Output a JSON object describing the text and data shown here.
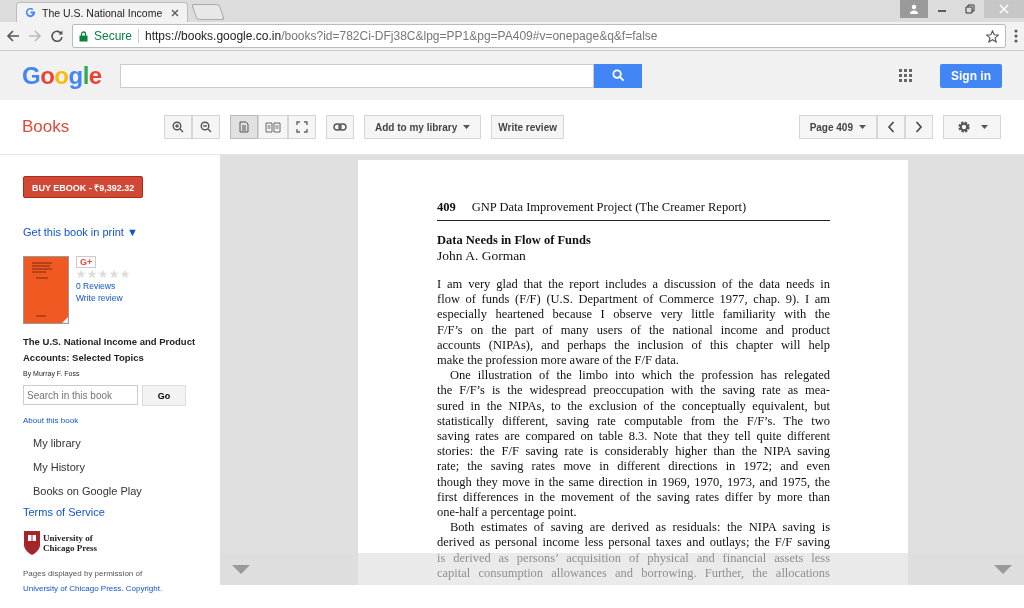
{
  "browser": {
    "tabs": [
      {
        "title": "The U.S. National Income",
        "selected": true
      }
    ],
    "secure_label": "Secure",
    "url_host": "https://books.google.co.in",
    "url_path": "/books?id=782Ci-DFj38C&lpg=PP1&pg=PA409#v=onepage&q&f=false"
  },
  "google_bar": {
    "logo": "Google",
    "sign_in": "Sign in"
  },
  "toolbar": {
    "title": "Books",
    "view_modes": [
      {
        "selected": true
      },
      {
        "selected": false
      },
      {
        "selected": false
      }
    ],
    "add_library": "Add to my library",
    "write_review": "Write review",
    "page": "Page 409"
  },
  "sidebar": {
    "buy": "BUY EBOOK - ₹9,392.32",
    "get_print": "Get this book in print ▼",
    "gplus": "G+",
    "stars": 0,
    "reviews": "0 Reviews",
    "write_review": "Write review",
    "book_title": "The U.S. National Income and Product Accounts: Selected Topics",
    "author": "By Murray F. Foss",
    "search_placeholder": "Search in this book",
    "go": "Go",
    "about": "About this book",
    "nav": [
      "My library",
      "My History",
      "Books on Google Play"
    ],
    "terms": "Terms of Service",
    "publisher": [
      "University of",
      "Chicago Press"
    ],
    "permission": "Pages displayed by permission of ",
    "permission_link": "University of Chicago Press.",
    "copyright": "Copyright."
  },
  "page": {
    "number": "409",
    "running_head": "GNP Data Improvement Project (The Creamer Report)",
    "heading": "Data Needs in Flow of Funds",
    "author": "John A. Gorman",
    "paragraphs": [
      [
        "I am very glad that the report includes a discussion of the data needs in",
        "flow of funds (F/F) (U.S. Department of Commerce 1977, chap. 9). I am",
        "especially heartened because I observe very little familiarity with the",
        "F/F’s on the part of many users of the national income and product",
        "accounts (NIPAs), and perhaps the inclusion of this chapter will help",
        "make the profession more aware of the F/F data."
      ],
      [
        "One illustration of the limbo into which the profession has relegated",
        "the F/F’s is the widespread preoccupation with the saving rate as mea-",
        "sured in the NIPAs, to the exclusion of the conceptually equivalent, but",
        "statistically different, saving rate computable from the F/F’s. The two",
        "saving rates are compared on table 8.3. Note that they tell quite different",
        "stories: the F/F saving rate is considerably higher than the NIPA saving",
        "rate; the saving rates move in different directions in 1972; and even",
        "though they move in the same direction in 1969, 1970, 1973, and 1975, the",
        "first differences in the movement of the saving rates differ by more than",
        "one-half a percentage point."
      ],
      [
        "Both estimates of saving are derived as residuals: the NIPA saving is",
        "derived as personal income less personal taxes and outlays; the F/F saving",
        "is derived as persons’ acquisition of physical and financial assets less",
        "capital consumption allowances and borrowing. Further, the allocations"
      ]
    ]
  }
}
